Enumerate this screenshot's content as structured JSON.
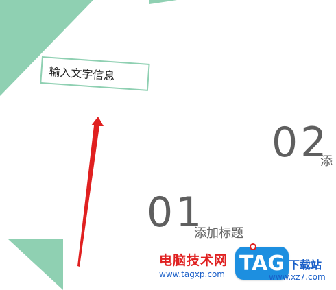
{
  "slide": {
    "textbox_label": "输入文字信息",
    "item2_number": "02",
    "item2_title": "添",
    "item1_number": "01",
    "item1_title": "添加标题"
  },
  "watermark": {
    "site_name": "电脑技术网",
    "site_url": "www.tagxp.com",
    "logo_text": "TAG",
    "site_name2": "下载站",
    "site_url2": "www.xz7.com"
  },
  "colors": {
    "accent_green": "#8fd0b2",
    "arrow_red": "#e02020",
    "number_gray": "#5f5f5f",
    "logo_blue": "#1d8fe0"
  }
}
